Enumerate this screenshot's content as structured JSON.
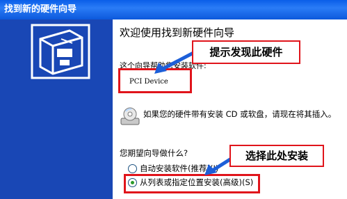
{
  "window": {
    "title": "找到新的硬件向导"
  },
  "wizard": {
    "heading": "欢迎使用找到新硬件向导",
    "description": "这个向导帮助您安装软件:",
    "device_name": "PCI Device",
    "cd_hint": "如果您的硬件带有安装 CD 或软盘，请现在将其插入。",
    "question": "您期望向导做什么?",
    "options": [
      {
        "label": "自动安装软件(推荐)(I)",
        "selected": false
      },
      {
        "label": "从列表或指定位置安装(高级)(S)",
        "selected": true
      }
    ]
  },
  "annotations": {
    "callout_hardware": "提示发现此硬件",
    "callout_install": "选择此处安装"
  },
  "colors": {
    "annotation": "#e0141b",
    "arrow": "#1d5fd8",
    "sidebar": "#1947b5"
  }
}
